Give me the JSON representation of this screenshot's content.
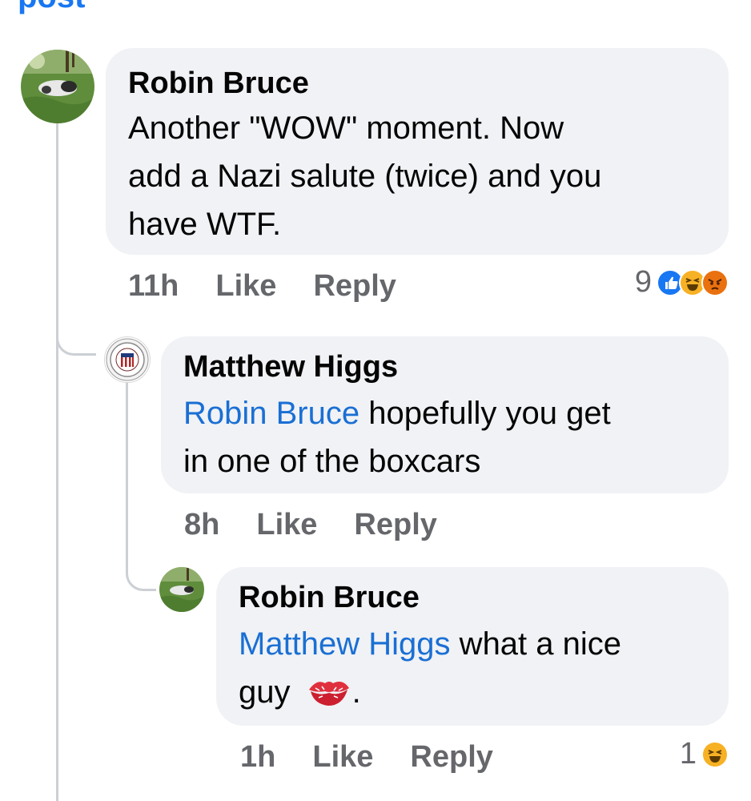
{
  "header": {
    "partial_link": "post"
  },
  "comments": [
    {
      "author": "Robin Bruce",
      "text": "Another \"WOW\" moment. Now add a Nazi salute (twice) and you have WTF.",
      "line1": "Another \"WOW\" moment. Now",
      "line2": "add a Nazi salute (twice) and you",
      "line3": "have WTF.",
      "time": "11h",
      "like": "Like",
      "reply": "Reply",
      "reaction_count": "9",
      "reactions": [
        "like-icon",
        "haha-icon",
        "angry-icon"
      ]
    },
    {
      "author": "Matthew Higgs",
      "mention": "Robin Bruce",
      "line1_rest": " hopefully you get",
      "line2": "in one of the boxcars",
      "time": "8h",
      "like": "Like",
      "reply": "Reply"
    },
    {
      "author": "Robin Bruce",
      "mention": "Matthew Higgs",
      "line1_rest": " what a nice",
      "line2": "guy ",
      "line2_end": ".",
      "emoji": "kiss-lips-icon",
      "time": "1h",
      "like": "Like",
      "reply": "Reply",
      "reaction_count": "1",
      "reactions": [
        "haha-icon"
      ]
    }
  ],
  "colors": {
    "link": "#1877f2",
    "mention": "#1a6fd4",
    "bubble": "#f0f2f5",
    "meta": "#65676b",
    "like": "#1877f2",
    "haha": "#f7b125",
    "angry": "#e9710f"
  }
}
